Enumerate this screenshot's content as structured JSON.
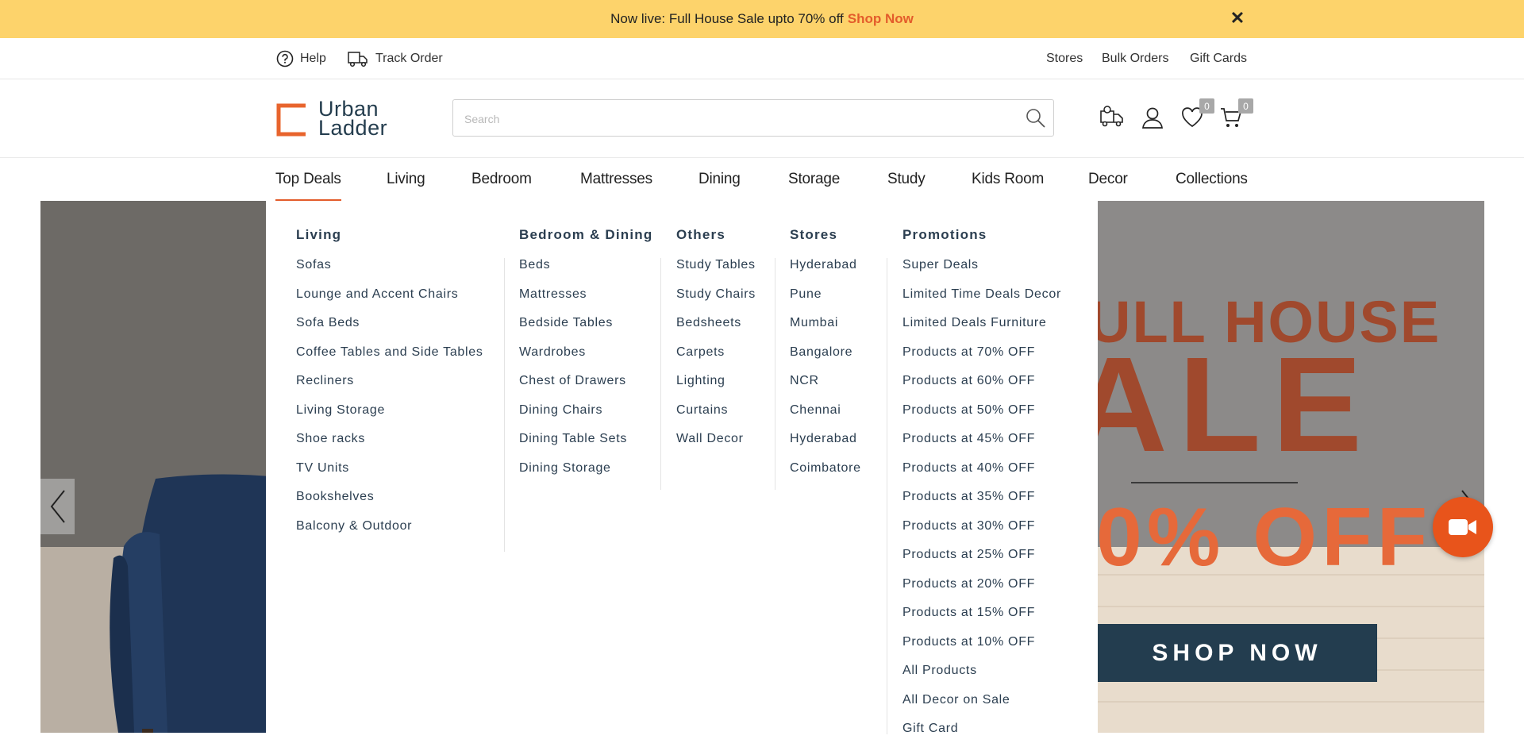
{
  "announcement": {
    "text": "Now live: Full House Sale upto 70% off",
    "cta": "Shop Now",
    "close": "✕"
  },
  "utility": {
    "help": "Help",
    "track_order": "Track Order",
    "stores": "Stores",
    "bulk_orders": "Bulk Orders",
    "gift_cards": "Gift Cards"
  },
  "logo": {
    "line1": "Urban",
    "line2": "Ladder"
  },
  "search": {
    "placeholder": "Search",
    "value": ""
  },
  "header": {
    "wishlist_count": "0",
    "cart_count": "0"
  },
  "nav": [
    "Top Deals",
    "Living",
    "Bedroom",
    "Mattresses",
    "Dining",
    "Storage",
    "Study",
    "Kids Room",
    "Decor",
    "Collections"
  ],
  "mega_menu": {
    "living": {
      "title": "Living",
      "items": [
        "Sofas",
        "Lounge and Accent Chairs",
        "Sofa Beds",
        "Coffee Tables and Side Tables",
        "Recliners",
        "Living Storage",
        "Shoe racks",
        "TV Units",
        "Bookshelves",
        "Balcony & Outdoor"
      ]
    },
    "bedroom_dining": {
      "title": "Bedroom & Dining",
      "items": [
        "Beds",
        "Mattresses",
        "Bedside Tables",
        "Wardrobes",
        "Chest of Drawers",
        "Dining Chairs",
        "Dining Table Sets",
        "Dining Storage"
      ]
    },
    "others": {
      "title": "Others",
      "items": [
        "Study Tables",
        "Study Chairs",
        "Bedsheets",
        "Carpets",
        "Lighting",
        "Curtains",
        "Wall Decor"
      ]
    },
    "stores": {
      "title": "Stores",
      "items": [
        "Hyderabad",
        "Pune",
        "Mumbai",
        "Bangalore",
        "NCR",
        "Chennai",
        "Hyderabad",
        "Coimbatore"
      ]
    },
    "promotions": {
      "title": "Promotions",
      "items": [
        "Super Deals",
        "Limited Time Deals Decor",
        "Limited Deals Furniture",
        "Products at 70% OFF",
        "Products at 60% OFF",
        "Products at 50% OFF",
        "Products at 45% OFF",
        "Products at 40% OFF",
        "Products at 35% OFF",
        "Products at 30% OFF",
        "Products at 25% OFF",
        "Products at 20% OFF",
        "Products at 15% OFF",
        "Products at 10% OFF",
        "All Products",
        "All Decor on Sale",
        "Gift Card"
      ]
    }
  },
  "hero": {
    "line1": "ULL HOUSE",
    "line2": "ALE",
    "line3": "0% OFF",
    "cta": "SHOP NOW"
  },
  "colors": {
    "accent": "#e35c2b",
    "brand_navy": "#233d4f",
    "announcement_bg": "#fdd36b",
    "video_button": "#e8541b"
  }
}
